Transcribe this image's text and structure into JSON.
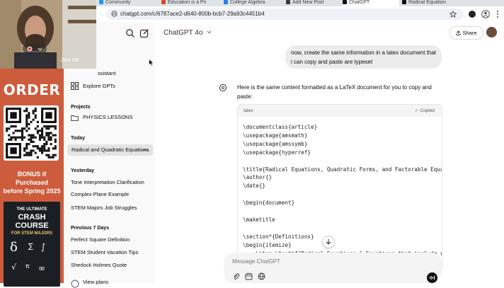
{
  "browser": {
    "tabs": [
      {
        "label": "Community"
      },
      {
        "label": "Education is a Pri"
      },
      {
        "label": "College Algebra"
      },
      {
        "label": "Add New Post"
      },
      {
        "label": "ChatGPT"
      },
      {
        "label": "Radical Equation"
      }
    ],
    "url": "chatgpt.com/c/6787ace2-d640-800b-bcb7-29a93c4451b4"
  },
  "webcam": {
    "label": "Zero KB"
  },
  "promo": {
    "order": "ORDER",
    "bonus_line1": "BONUS if Purchased",
    "bonus_line2": "before Spring 2025",
    "book_line1": "THE ULTIMATE",
    "book_line2": "CRASH COURSE",
    "book_line3": "FOR STEM MAJORS",
    "colors": {
      "banner": "#cc5c3c",
      "book": "#1b1f24"
    }
  },
  "sidebar": {
    "partial_item": "ssistant",
    "explore": "Explore GPTs",
    "projects_heading": "Projects",
    "project": "PHYSICS LESSONS",
    "today_heading": "Today",
    "today_items": [
      "Radical and Quadratic Equations"
    ],
    "yesterday_heading": "Yesterday",
    "yesterday_items": [
      "Tone Interpretation Clarification",
      "Complex Plane Example",
      "STEM Majors Job Struggles"
    ],
    "prev7_heading": "Previous 7 Days",
    "prev7_items": [
      "Perfect Square Definition",
      "STEM Student Vacation Tips",
      "Sherlock Holmes Quote"
    ],
    "view_plans": "View plans"
  },
  "main": {
    "model": "ChatGPT 4o",
    "share": "Share",
    "user_message": "now, create the same information in a latex document that i can copy and paste are typeset",
    "assistant_intro": "Here is the same content formatted as a LaTeX document for you to copy and paste:",
    "code_lang": "latex",
    "copied": "✓ Copied",
    "code": "\\documentclass{article}\n\\usepackage{amsmath}\n\\usepackage{amssymb}\n\\usepackage{hyperref}\n\n\\title{Radical Equations, Quadratic Forms, and Factorable Equations}\n\\author{}\n\\date{}\n\n\\begin{document}\n\n\\maketitle\n\n\\section*{Definitions}\n\\begin{itemize}\n    \\item \\textbf{Radical Equations:} Equations that include variab",
    "composer_placeholder": "Message ChatGPT"
  }
}
